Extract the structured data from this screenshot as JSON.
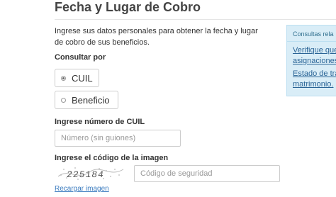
{
  "page": {
    "title": "Fecha y Lugar de Cobro",
    "intro": "Ingrese sus datos personales para obtener la fecha y lugar de cobro de sus beneficios."
  },
  "consultar": {
    "label": "Consultar por",
    "options": [
      {
        "label": "CUIL",
        "selected": true
      },
      {
        "label": "Beneficio",
        "selected": false
      }
    ]
  },
  "cuil_field": {
    "label": "Ingrese número de CUIL",
    "placeholder": "Número (sin guiones)",
    "value": ""
  },
  "captcha": {
    "label": "Ingrese el código de la imagen",
    "image_text": "225184",
    "placeholder": "Código de seguridad",
    "value": "",
    "reload_link": "Recargar imagen"
  },
  "sidebar": {
    "title": "Consultas rela",
    "links": [
      "Verifique que",
      "asignaciones",
      "Estado de trá",
      "matrimonio."
    ]
  },
  "colors": {
    "link": "#3a7bbf",
    "sidebar_bg": "#d9edf7",
    "sidebar_border": "#bcdff1"
  }
}
